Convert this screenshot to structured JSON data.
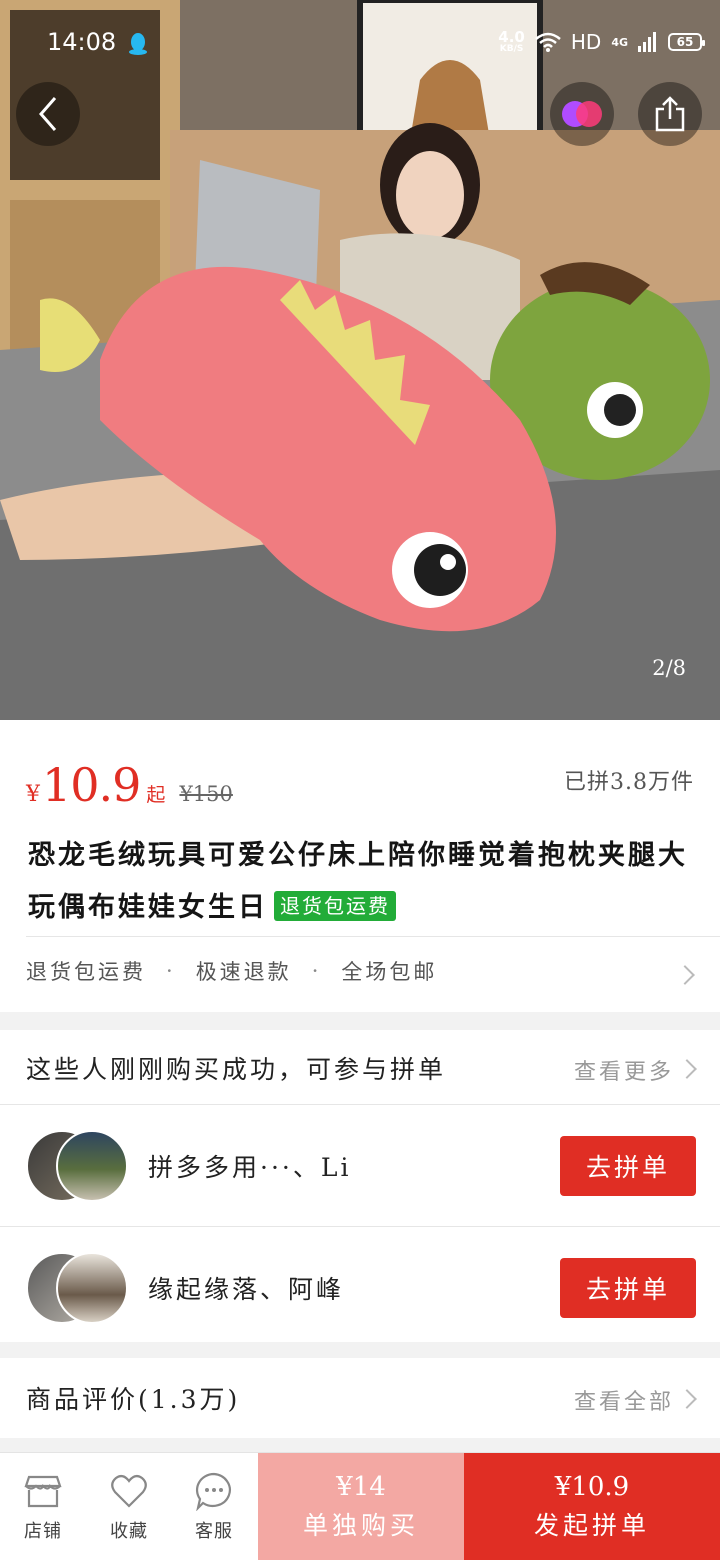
{
  "status_bar": {
    "time": "14:08",
    "net_speed": "4.0",
    "net_unit": "KB/S",
    "hd": "HD",
    "network": "4G",
    "battery": "65"
  },
  "hero": {
    "photo_counter": "2/8"
  },
  "product": {
    "currency": "¥",
    "price": "10.9",
    "price_suffix": "起",
    "original_price": "¥150",
    "sold": "已拼3.8万件",
    "title": "恐龙毛绒玩具可爱公仔床上陪你睡觉着抱枕夹腿大玩偶布娃娃女生日",
    "title_tag": "退货包运费",
    "services": [
      "退货包运费",
      "极速退款",
      "全场包邮"
    ],
    "service_separator": "·"
  },
  "group_buy": {
    "heading": "这些人刚刚购买成功，可参与拼单",
    "more": "查看更多",
    "rows": [
      {
        "names": "拼多多用···、Li",
        "button": "去拼单"
      },
      {
        "names": "缘起缘落、阿峰",
        "button": "去拼单"
      }
    ]
  },
  "reviews": {
    "title": "商品评价(1.3万)",
    "more": "查看全部"
  },
  "bottom_bar": {
    "tabs": [
      {
        "label": "店铺",
        "icon": "store-icon"
      },
      {
        "label": "收藏",
        "icon": "heart-icon"
      },
      {
        "label": "客服",
        "icon": "chat-icon"
      }
    ],
    "solo": {
      "price": "¥14",
      "label": "单独购买"
    },
    "group": {
      "price": "¥10.9",
      "label": "发起拼单"
    }
  },
  "colors": {
    "accent": "#e02e24",
    "solo_bg": "#f3a8a3",
    "tag_green": "#22ac38"
  }
}
